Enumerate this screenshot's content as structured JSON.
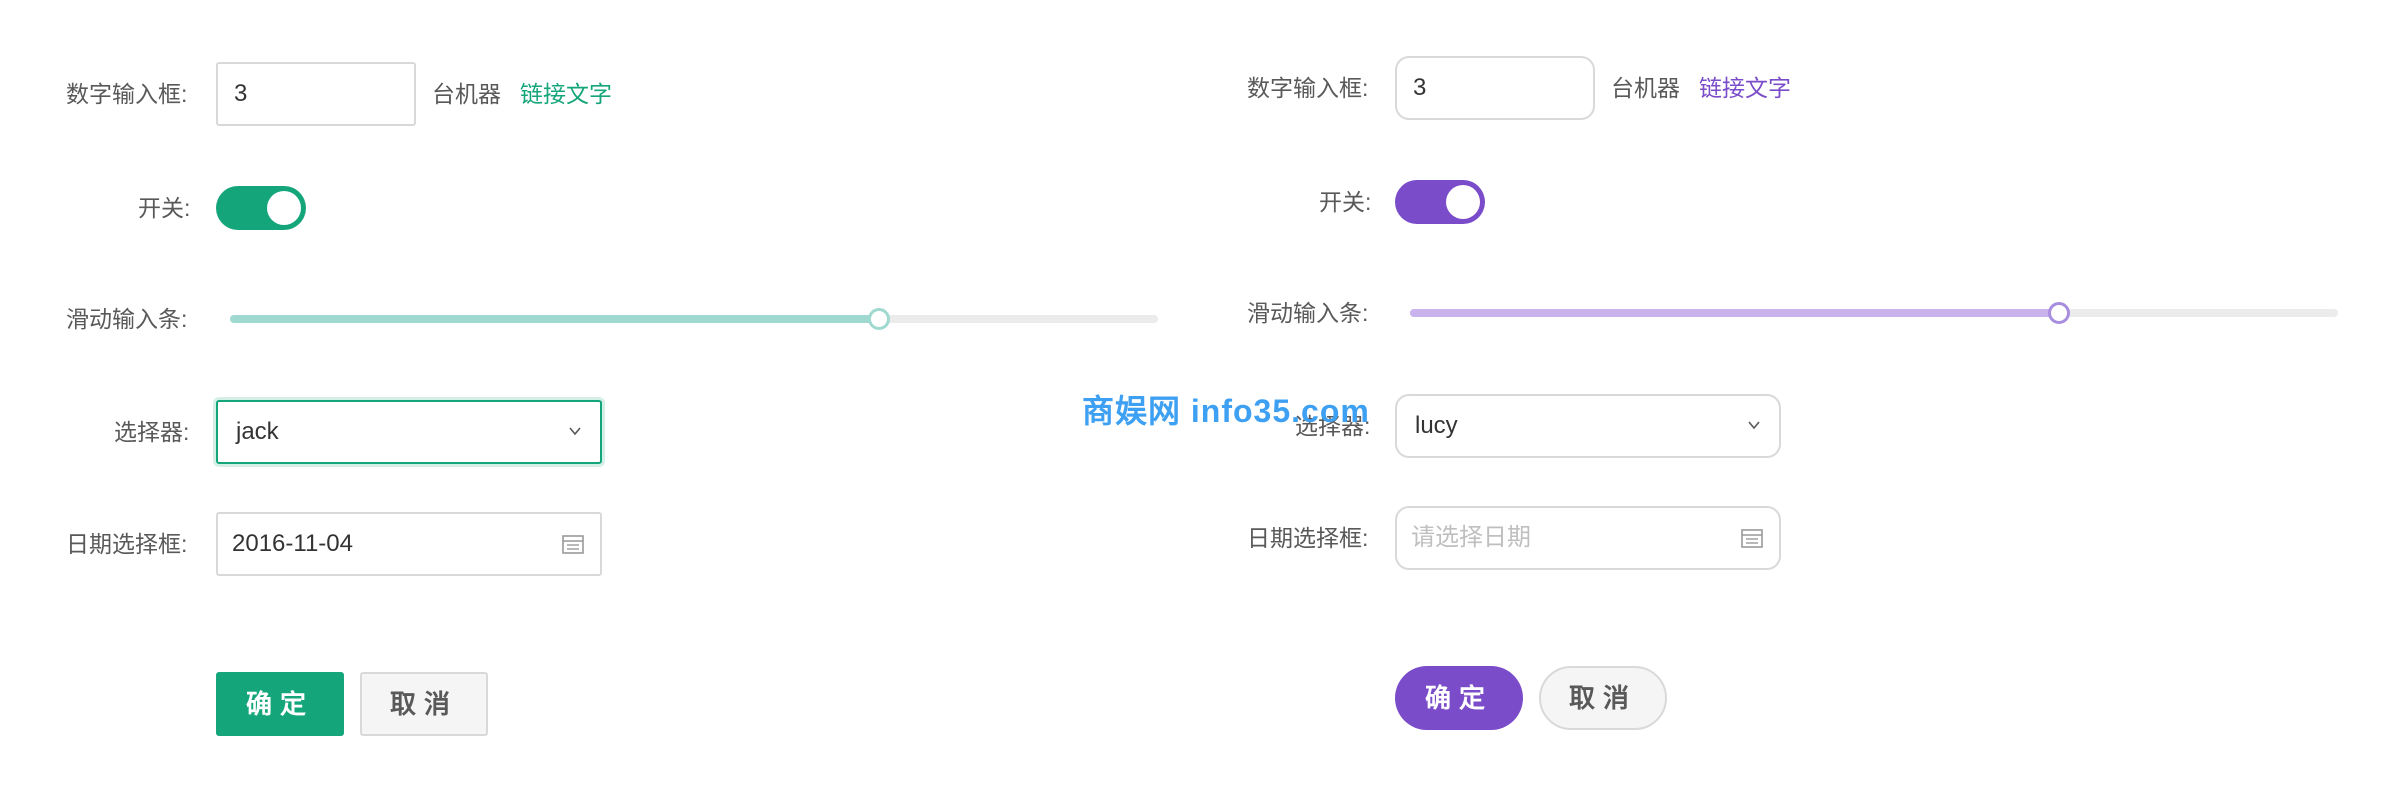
{
  "left_form": {
    "theme_color": "#14a67a",
    "theme_light": "#9fd9cf",
    "number_label": "数字输入框:",
    "number_value": "3",
    "number_suffix": "台机器",
    "link_text": "链接文字",
    "switch_label": "开关:",
    "switch_on": true,
    "slider_label": "滑动输入条:",
    "slider_value_fraction": 0.7,
    "select_label": "选择器:",
    "select_value": "jack",
    "date_label": "日期选择框:",
    "date_value": "2016-11-04",
    "confirm_label": "确定",
    "cancel_label": "取消"
  },
  "right_form": {
    "theme_color": "#7a4cc9",
    "theme_light": "#c9b3ec",
    "number_label": "数字输入框:",
    "number_value": "3",
    "number_suffix": "台机器",
    "link_text": "链接文字",
    "switch_label": "开关:",
    "switch_on": true,
    "slider_label": "滑动输入条:",
    "slider_value_fraction": 0.7,
    "select_label": "选择器:",
    "select_value": "lucy",
    "date_label": "日期选择框:",
    "date_placeholder": "请选择日期",
    "confirm_label": "确定",
    "cancel_label": "取消"
  },
  "watermark": "商娱网 info35.com"
}
